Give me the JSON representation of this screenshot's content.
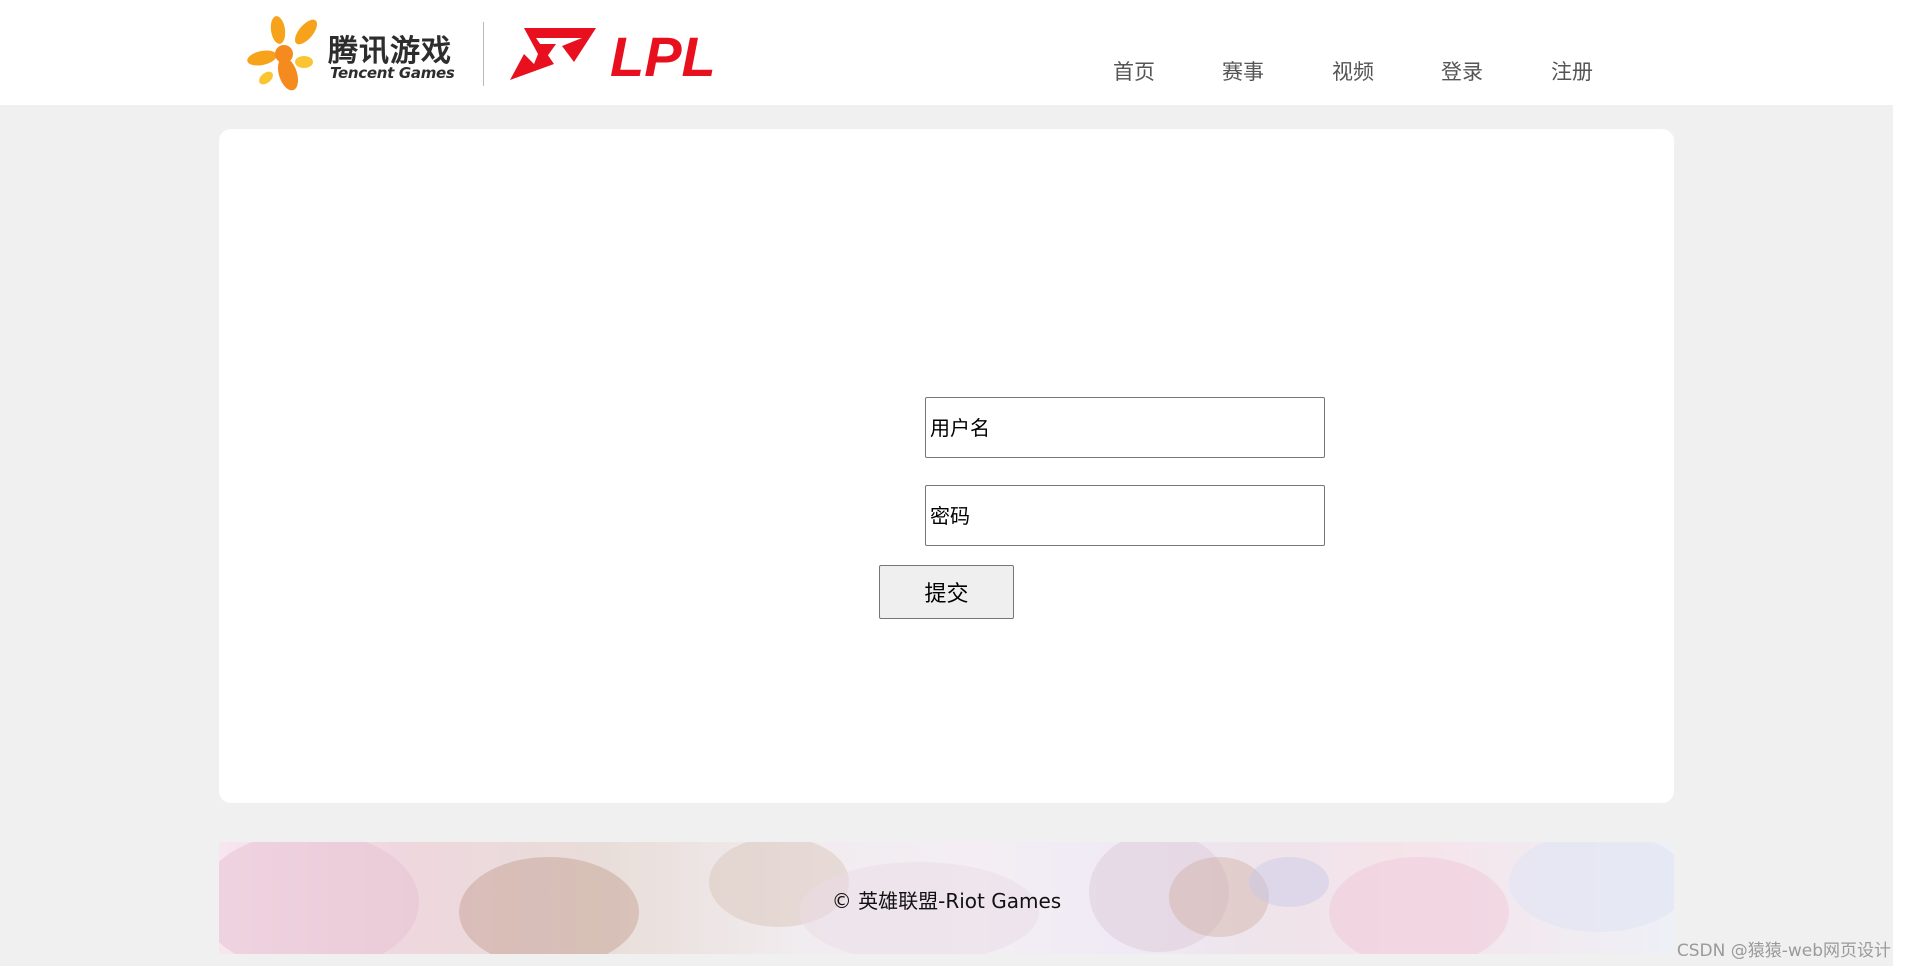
{
  "header": {
    "tencent_logo_cn": "腾讯游戏",
    "tencent_logo_en": "Tencent Games",
    "lpl_logo_text": "LPL",
    "nav": [
      {
        "label": "首页"
      },
      {
        "label": "赛事"
      },
      {
        "label": "视频"
      },
      {
        "label": "登录"
      },
      {
        "label": "注册"
      }
    ]
  },
  "login_form": {
    "username_placeholder": "用户名",
    "password_placeholder": "密码",
    "submit_label": "提交"
  },
  "footer": {
    "copyright": "© 英雄联盟-Riot Games"
  },
  "watermark": "CSDN @猿猿-web网页设计",
  "colors": {
    "page_background": "#f0f0f0",
    "lpl_red": "#e8101e",
    "tencent_orange": "#f7a21b"
  }
}
